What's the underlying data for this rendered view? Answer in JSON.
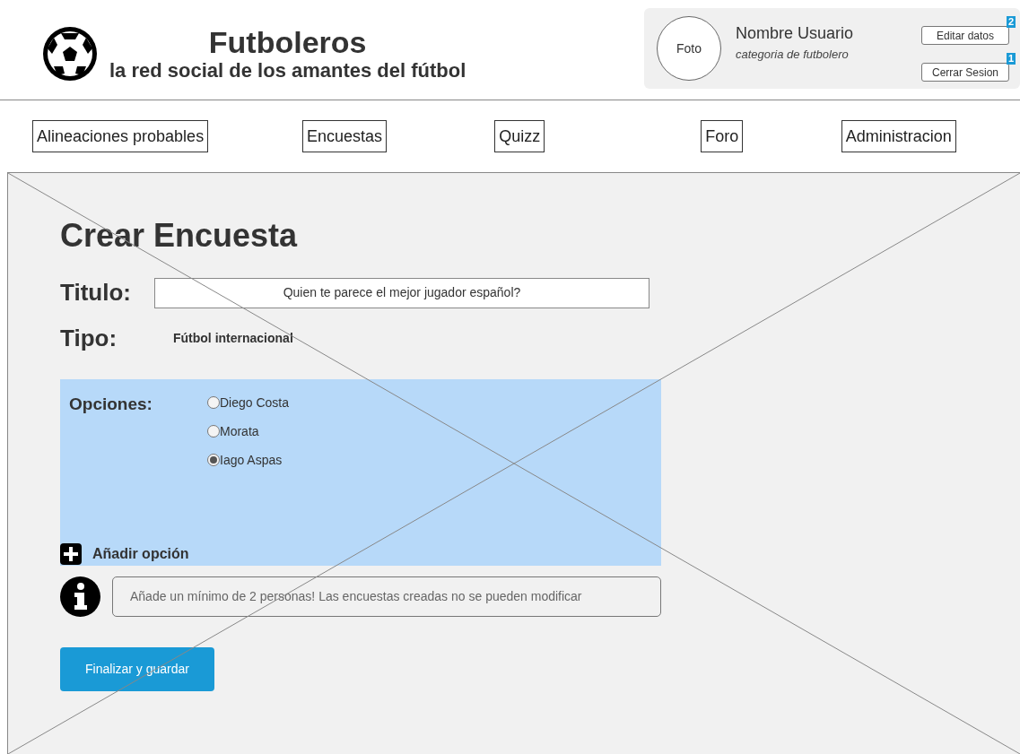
{
  "header": {
    "title": "Futboleros",
    "subtitle": "la red social de los amantes del fútbol"
  },
  "user": {
    "photo": "Foto",
    "name": "Nombre Usuario",
    "category": "categoria de futbolero",
    "buttons": [
      {
        "label": "Editar datos",
        "badge": "2"
      },
      {
        "label": "Cerrar Sesion",
        "badge": "1"
      }
    ]
  },
  "nav": [
    {
      "label": "Alineaciones probables"
    },
    {
      "label": "Encuestas"
    },
    {
      "label": "Quizz"
    },
    {
      "label": "Foro"
    },
    {
      "label": "Administracion"
    }
  ],
  "form": {
    "heading": "Crear Encuesta",
    "title_label": "Titulo:",
    "title_value": "Quien te parece el mejor jugador español?",
    "type_label": "Tipo:",
    "type_value": "Fútbol internacional",
    "options_label": "Opciones:",
    "options": [
      {
        "label": "Diego Costa",
        "selected": false
      },
      {
        "label": "Morata",
        "selected": false
      },
      {
        "label": "Iago Aspas",
        "selected": true
      }
    ],
    "add_option": "Añadir opción",
    "info": "Añade un mínimo de 2 personas! Las encuestas creadas no se pueden modificar",
    "submit": "Finalizar y guardar"
  }
}
